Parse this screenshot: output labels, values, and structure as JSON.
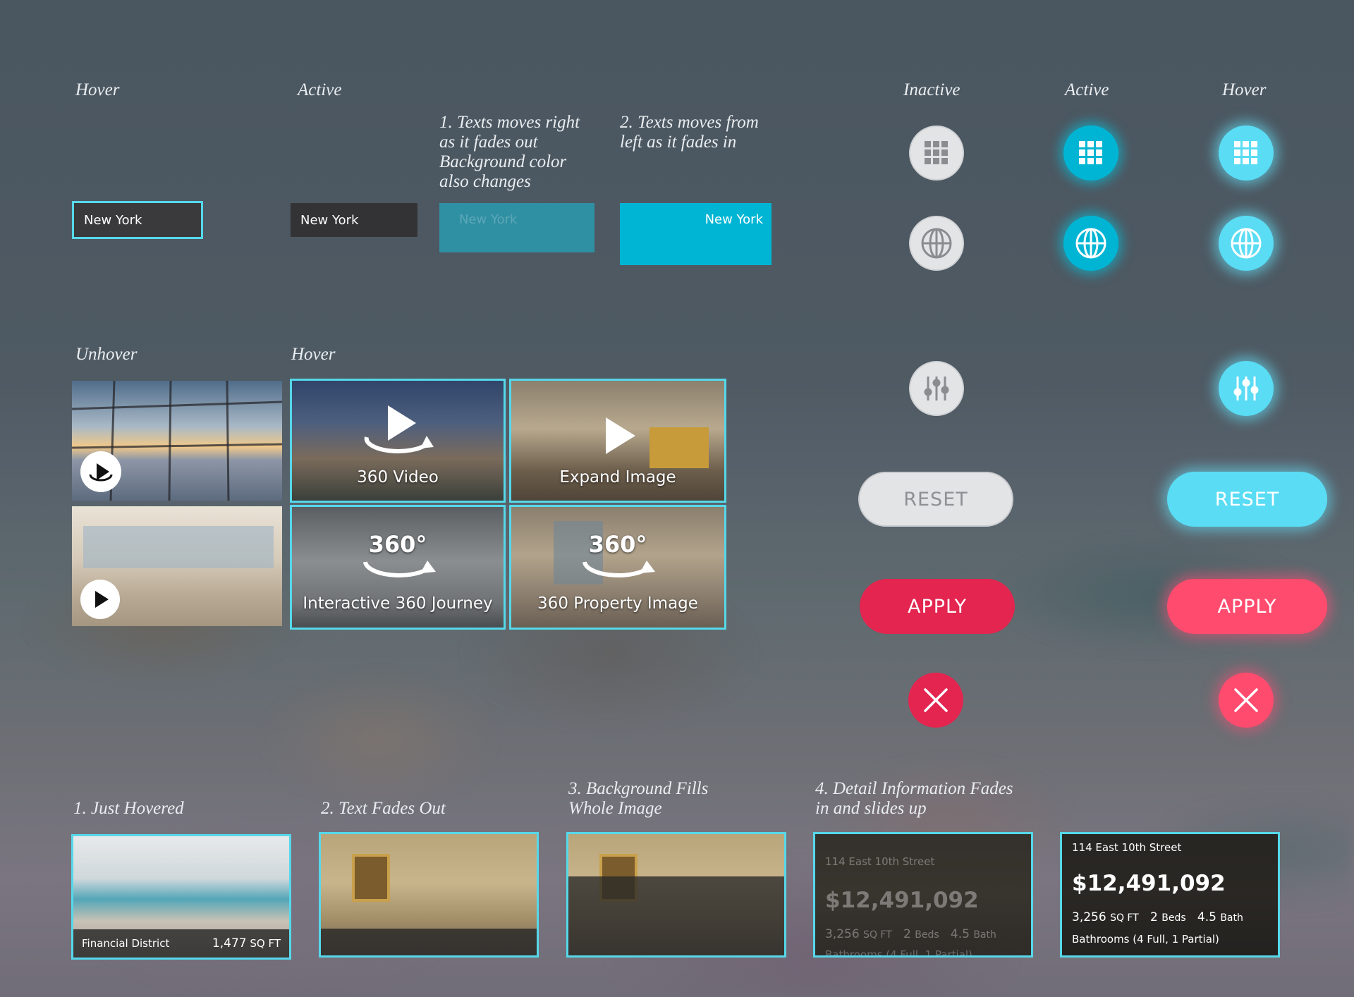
{
  "labels": {
    "hover_field": "Hover",
    "active_field": "Active",
    "step1_fade": "1. Texts moves right\nas it fades out\nBackground color\nalso changes",
    "step2_fade": "2. Texts moves from\nleft as it fades in",
    "inactive_col": "Inactive",
    "active_col": "Active",
    "hover_col": "Hover",
    "unhover": "Unhover",
    "hover_thumbs": "Hover",
    "card_step1": "1. Just Hovered",
    "card_step2": "2. Text Fades Out",
    "card_step3": "3. Background Fills\nWhole Image",
    "card_step4": "4. Detail Information Fades\nin and slides up"
  },
  "fields": {
    "hover_value": "New York",
    "active_value": "New York",
    "fading_value": "New York",
    "fadein_value": "New York"
  },
  "icons": {
    "grid": "grid-icon",
    "globe": "globe-icon",
    "filter": "sliders-icon",
    "close": "close-icon",
    "play": "play-icon",
    "rotate360": "rotate-360-icon"
  },
  "buttons": {
    "reset_label": "RESET",
    "apply_label": "APPLY"
  },
  "thumbs": {
    "video_label": "360 Video",
    "expand_label": "Expand Image",
    "journey_label": "Interactive 360 Journey",
    "property_label": "360 Property Image",
    "badge_360": "360°"
  },
  "cards": {
    "neighborhood": "Financial District",
    "sqft_value": "1,477",
    "sqft_unit": "SQ FT",
    "address": "114 East 10th Street",
    "price": "$12,491,092",
    "area_value": "3,256",
    "area_unit": "SQ FT",
    "beds_value": "2",
    "beds_label": "Beds",
    "bath_value": "4.5",
    "bath_label": "Bath",
    "bathrooms_detail": "Bathrooms (4 Full, 1 Partial)"
  },
  "colors": {
    "accent_cyan": "#00b5d4",
    "hover_cyan": "#59dcf4",
    "apply_red": "#e3254f",
    "apply_hover": "#ff4b6e",
    "inactive_gray": "#e3e4e6",
    "highlight_border": "#56d8ea"
  }
}
